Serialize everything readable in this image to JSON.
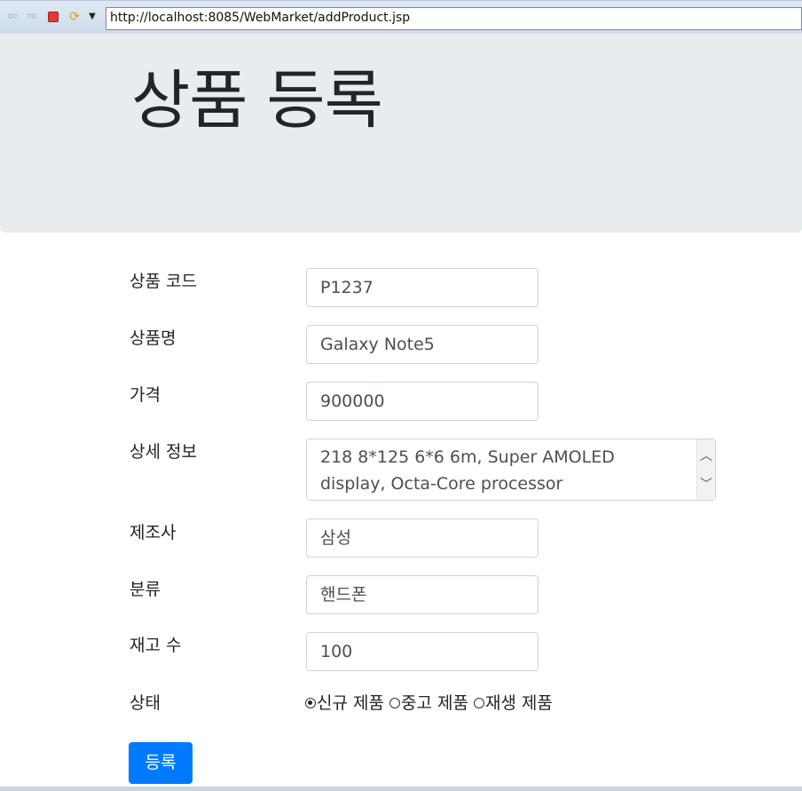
{
  "browser": {
    "url": "http://localhost:8085/WebMarket/addProduct.jsp",
    "icons": [
      "back-arrow-icon",
      "forward-arrow-icon",
      "stop-icon",
      "refresh-icon",
      "menu-dropdown-icon"
    ]
  },
  "header": {
    "title": "상품 등록"
  },
  "form": {
    "product_id": {
      "label": "상품 코드",
      "value": "P1237"
    },
    "name": {
      "label": "상품명",
      "value": "Galaxy Note5"
    },
    "unit_price": {
      "label": "가격",
      "value": "900000"
    },
    "description": {
      "label": "상세 정보",
      "value": "218 8*125 6*6 6m, Super AMOLED display, Octa-Core processor"
    },
    "manufacturer": {
      "label": "제조사",
      "value": "삼성"
    },
    "category": {
      "label": "분류",
      "value": "핸드폰"
    },
    "units_in_stock": {
      "label": "재고 수",
      "value": "100"
    },
    "condition": {
      "label": "상태",
      "options": [
        {
          "label": "신규 제품",
          "checked": true
        },
        {
          "label": "중고 제품",
          "checked": false
        },
        {
          "label": "재생 제품",
          "checked": false
        }
      ]
    },
    "submit_label": "등록"
  },
  "colors": {
    "jumbotron_bg": "#e9ecef",
    "primary_button": "#007bff",
    "input_border": "#ced4da"
  }
}
